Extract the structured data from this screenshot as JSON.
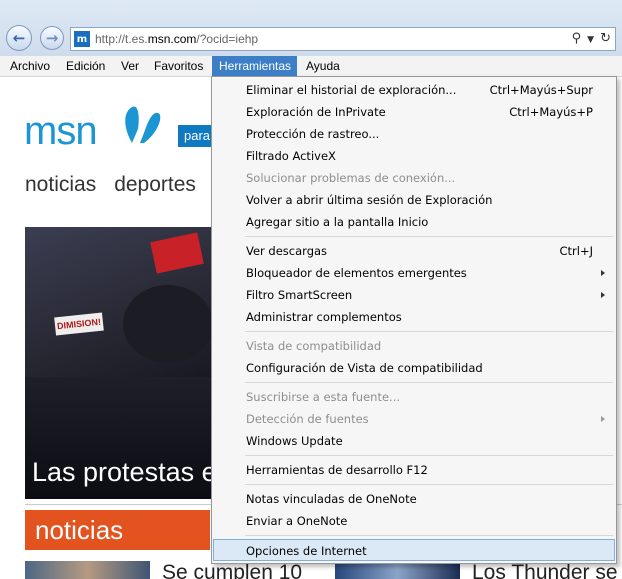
{
  "address_bar": {
    "url_prefix": "http://t.es.",
    "url_host": "msn.com",
    "url_suffix": "/?ocid=iehp",
    "search_icon": "magnifier-icon",
    "dropdown_icon": "chevron-down-icon",
    "refresh_icon": "refresh-icon"
  },
  "menubar": {
    "items": [
      "Archivo",
      "Edición",
      "Ver",
      "Favoritos",
      "Herramientas",
      "Ayuda"
    ],
    "active": "Herramientas"
  },
  "page": {
    "logo": "msn",
    "para": "para",
    "nav": [
      "noticias",
      "deportes"
    ],
    "hero_caption": "Las protestas e",
    "hero_sign": "DIMISION!",
    "section": "noticias",
    "story1": "Se cumplen 10",
    "story2": "Los Thunder se"
  },
  "tools_menu": {
    "items": [
      {
        "label": "Eliminar el historial de exploración...",
        "shortcut": "Ctrl+Mayús+Supr"
      },
      {
        "label": "Exploración de InPrivate",
        "shortcut": "Ctrl+Mayús+P"
      },
      {
        "label": "Protección de rastreo..."
      },
      {
        "label": "Filtrado ActiveX"
      },
      {
        "label": "Solucionar problemas de conexión...",
        "disabled": true
      },
      {
        "label": "Volver a abrir última sesión de Exploración"
      },
      {
        "label": "Agregar sitio a la pantalla Inicio"
      },
      {
        "label": "Ver descargas",
        "shortcut": "Ctrl+J"
      },
      {
        "label": "Bloqueador de elementos emergentes",
        "submenu": true
      },
      {
        "label": "Filtro SmartScreen",
        "submenu": true
      },
      {
        "label": "Administrar complementos"
      },
      {
        "label": "Vista de compatibilidad",
        "disabled": true
      },
      {
        "label": "Configuración de Vista de compatibilidad"
      },
      {
        "label": "Suscribirse a esta fuente...",
        "disabled": true
      },
      {
        "label": "Detección de fuentes",
        "disabled": true,
        "submenu": true
      },
      {
        "label": "Windows Update"
      },
      {
        "label": "Herramientas de desarrollo F12"
      },
      {
        "label": "Notas vinculadas de OneNote"
      },
      {
        "label": "Enviar a OneNote"
      },
      {
        "label": "Opciones de Internet",
        "hover": true
      }
    ]
  }
}
